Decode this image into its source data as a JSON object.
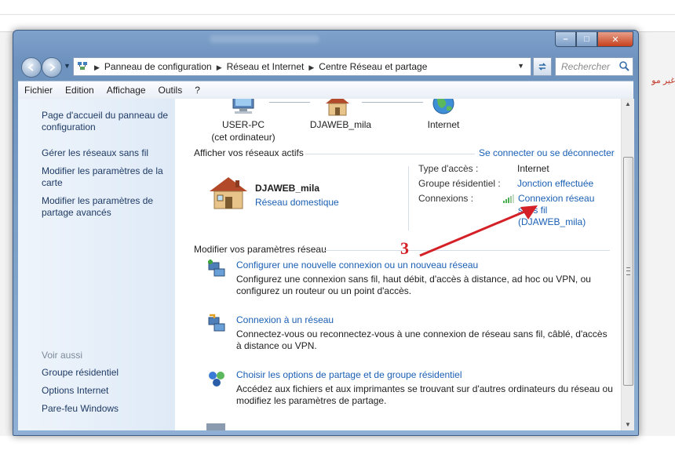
{
  "window": {
    "caption": {
      "minimize": "–",
      "maximize": "□",
      "close": "✕"
    }
  },
  "navigation": {
    "breadcrumbs": [
      "Panneau de configuration",
      "Réseau et Internet",
      "Centre Réseau et partage"
    ],
    "search_placeholder": "Rechercher"
  },
  "menu": [
    "Fichier",
    "Edition",
    "Affichage",
    "Outils",
    "?"
  ],
  "sidebar": {
    "links": [
      "Page d'accueil du panneau de configuration",
      "Gérer les réseaux sans fil",
      "Modifier les paramètres de la carte",
      "Modifier les paramètres de partage avancés"
    ],
    "see_also_heading": "Voir aussi",
    "see_also": [
      "Groupe résidentiel",
      "Options Internet",
      "Pare-feu Windows"
    ]
  },
  "network_map": {
    "nodes": [
      {
        "name": "USER-PC",
        "sub": "(cet ordinateur)",
        "icon": "computer-icon"
      },
      {
        "name": "DJAWEB_mila",
        "icon": "house-icon"
      },
      {
        "name": "Internet",
        "icon": "globe-icon"
      }
    ]
  },
  "active_networks": {
    "heading": "Afficher vos réseaux actifs",
    "connect_link": "Se connecter ou se déconnecter",
    "network_name": "DJAWEB_mila",
    "network_type": "Réseau domestique",
    "details": {
      "access_label": "Type d'accès :",
      "access_value": "Internet",
      "group_label": "Groupe résidentiel :",
      "group_value": "Jonction effectuée",
      "connections_label": "Connexions :",
      "connection_line1": "Connexion réseau",
      "connection_line2": "sans fil",
      "connection_line3": "(DJAWEB_mila)"
    }
  },
  "settings": {
    "heading": "Modifier vos paramètres réseau",
    "annotation": "3",
    "tasks": [
      {
        "title": "Configurer une nouvelle connexion ou un nouveau réseau",
        "desc": "Configurez une connexion sans fil, haut débit, d'accès à distance, ad hoc ou VPN, ou configurez un routeur ou un point d'accès."
      },
      {
        "title": "Connexion à un réseau",
        "desc": "Connectez-vous ou reconnectez-vous à une connexion de réseau sans fil, câblé, d'accès à distance ou VPN."
      },
      {
        "title": "Choisir les options de partage et de groupe résidentiel",
        "desc": "Accédez aux fichiers et aux imprimantes se trouvant sur d'autres ordinateurs du réseau ou modifiez les paramètres de partage."
      }
    ]
  },
  "colors": {
    "link": "#1a5fb4",
    "annotation": "#d42027",
    "sidebar_bg": "#e6eef8"
  }
}
